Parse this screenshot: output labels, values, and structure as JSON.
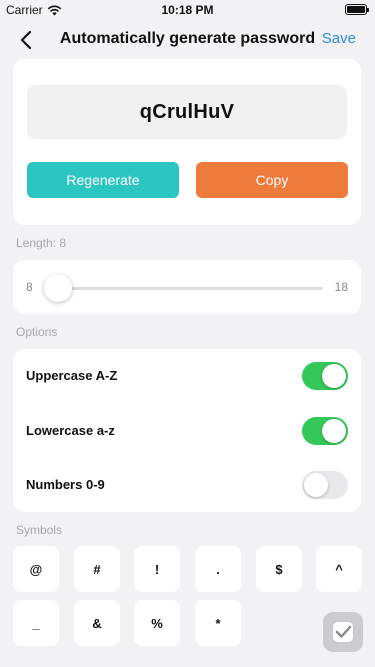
{
  "status_bar": {
    "carrier": "Carrier",
    "time": "10:18 PM"
  },
  "nav": {
    "title": "Automatically generate password",
    "save_label": "Save",
    "back_icon": "chevron-left-icon"
  },
  "generator": {
    "password": "qCrulHuV",
    "regenerate_label": "Regenerate",
    "copy_label": "Copy"
  },
  "length": {
    "label": "Length: 8",
    "min": "8",
    "max": "18",
    "value": 8
  },
  "options": {
    "header": "Options",
    "items": [
      {
        "label": "Uppercase A-Z",
        "on": true
      },
      {
        "label": "Lowercase a-z",
        "on": true
      },
      {
        "label": "Numbers 0-9",
        "on": false
      }
    ]
  },
  "symbols": {
    "header": "Symbols",
    "keys": [
      "@",
      "#",
      "!",
      ".",
      "$",
      "^",
      "_",
      "&",
      "%",
      "*"
    ]
  },
  "colors": {
    "accent": "#2b8de0",
    "regenerate": "#2cc6c2",
    "copy": "#ee7b3c",
    "toggle_on": "#34c759"
  }
}
